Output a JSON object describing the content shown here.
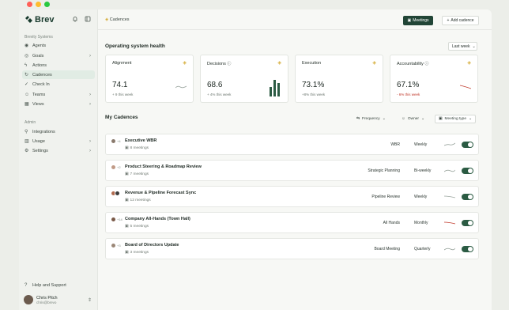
{
  "colors": {
    "brand": "#214536",
    "accent_green": "#2b5b43",
    "negative": "#c0392b",
    "emoji": "#d4aa33"
  },
  "app": {
    "logo_text": "Brev"
  },
  "sidebar": {
    "section1": "Brevity Systems",
    "items": [
      {
        "label": "Agents",
        "icon": "bot-icon"
      },
      {
        "label": "Goals",
        "icon": "target-icon",
        "chevron": true
      },
      {
        "label": "Actions",
        "icon": "lightning-icon"
      },
      {
        "label": "Cadences",
        "icon": "cycle-icon",
        "active": true
      },
      {
        "label": "Check In",
        "icon": "check-circle-icon"
      },
      {
        "label": "Teams",
        "icon": "users-icon",
        "chevron": true
      },
      {
        "label": "Views",
        "icon": "grid-icon",
        "chevron": true
      }
    ],
    "section2": "Admin",
    "admin_items": [
      {
        "label": "Integrations",
        "icon": "plug-icon"
      },
      {
        "label": "Usage",
        "icon": "chart-icon",
        "chevron": true
      },
      {
        "label": "Settings",
        "icon": "gear-icon",
        "chevron": true
      }
    ],
    "help": "Help and Support",
    "user": {
      "name": "Chris Pitch",
      "email": "chris@brevo"
    }
  },
  "topbar": {
    "breadcrumb": "Cadences",
    "meetings_button": "Meetings",
    "add_button": "Add cadence"
  },
  "health": {
    "title": "Operating system health",
    "period": "Last week",
    "metrics": [
      {
        "label": "Alignment",
        "value": "74.1",
        "change": "+ 9 this week"
      },
      {
        "label": "Decisions",
        "value": "68.6",
        "change": "+ 4% this week"
      },
      {
        "label": "Execution",
        "value": "73.1%",
        "change": "+8% this week"
      },
      {
        "label": "Accountability",
        "value": "67.1%",
        "change": "- 6% this week"
      }
    ]
  },
  "cadences": {
    "title": "My Cadences",
    "filters": {
      "frequency": "Frequency",
      "owner": "Owner",
      "meeting_type": "Meeting type"
    },
    "rows": [
      {
        "title": "Executive WBR",
        "more": "+4",
        "meetings": "8 meetings",
        "type": "WBR",
        "freq": "Weekly",
        "trend": "up"
      },
      {
        "title": "Product Steering & Roadmap Review",
        "more": "+2",
        "meetings": "7 meetings",
        "type": "Strategic Planning",
        "freq": "Bi-weekly",
        "trend": "up"
      },
      {
        "title": "Revenue & Pipeline Forecast Sync",
        "more": "",
        "meetings": "12 meetings",
        "type": "Pipeline Review",
        "freq": "Weekly",
        "trend": "down"
      },
      {
        "title": "Company All-Hands (Town Hall)",
        "more": "+14",
        "meetings": "5 meetings",
        "type": "All Hands",
        "freq": "Monthly",
        "trend": "negative"
      },
      {
        "title": "Board of Directors Update",
        "more": "+3",
        "meetings": "3 meetings",
        "type": "Board Meeting",
        "freq": "Quarterly",
        "trend": "up"
      }
    ]
  }
}
